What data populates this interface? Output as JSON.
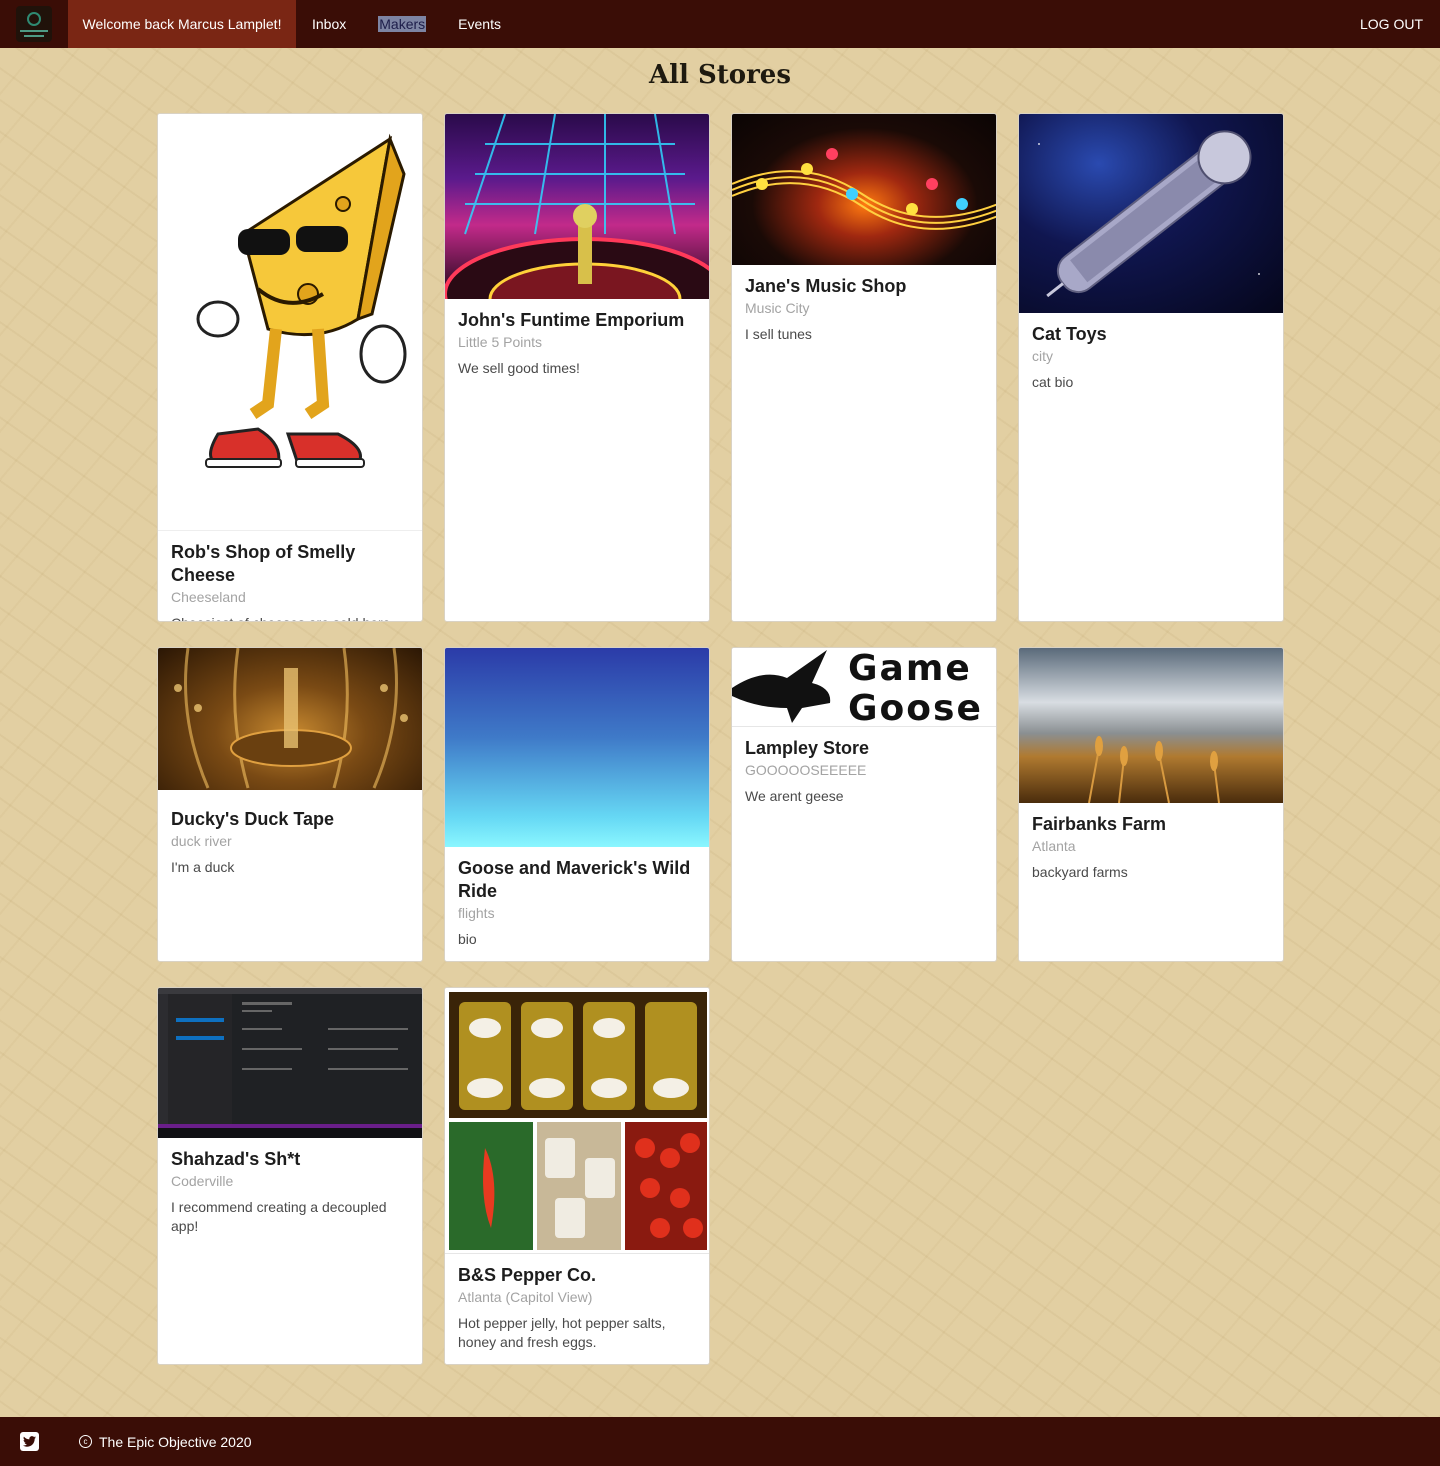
{
  "nav": {
    "welcome": "Welcome back Marcus Lamplet!",
    "inbox": "Inbox",
    "makers": "Makers",
    "events": "Events",
    "logout": "LOG OUT"
  },
  "page_title": "All Stores",
  "stores": [
    {
      "name": "Rob's Shop of Smelly Cheese",
      "city": "Cheeseland",
      "bio": "Cheesiest of cheeses are sold here"
    },
    {
      "name": "John's Funtime Emporium",
      "city": "Little 5 Points",
      "bio": "We sell good times!"
    },
    {
      "name": "Jane's Music Shop",
      "city": "Music City",
      "bio": "I sell tunes"
    },
    {
      "name": "Cat Toys",
      "city": "city",
      "bio": "cat bio"
    },
    {
      "name": "Ducky's Duck Tape",
      "city": "duck river",
      "bio": "I'm a duck"
    },
    {
      "name": "Goose and Maverick's Wild Ride",
      "city": "flights",
      "bio": "bio"
    },
    {
      "name": "Lampley Store",
      "city": "GOOOOOSEEEEE",
      "bio": "We arent geese",
      "image_text_1": "Game",
      "image_text_2": "Goose"
    },
    {
      "name": "Fairbanks Farm",
      "city": "Atlanta",
      "bio": "backyard farms"
    },
    {
      "name": "Shahzad's Sh*t",
      "city": "Coderville",
      "bio": "I recommend creating a decoupled app!"
    },
    {
      "name": "B&S Pepper Co.",
      "city": "Atlanta (Capitol View)",
      "bio": "Hot pepper jelly, hot pepper salts, honey and fresh eggs."
    }
  ],
  "footer": {
    "copyright": "The Epic Objective 2020",
    "social_icon": "twitter-icon"
  },
  "colors": {
    "nav_bg": "#3a0d06",
    "nav_active": "#7a2614",
    "page_bg": "#e2cfa2"
  }
}
